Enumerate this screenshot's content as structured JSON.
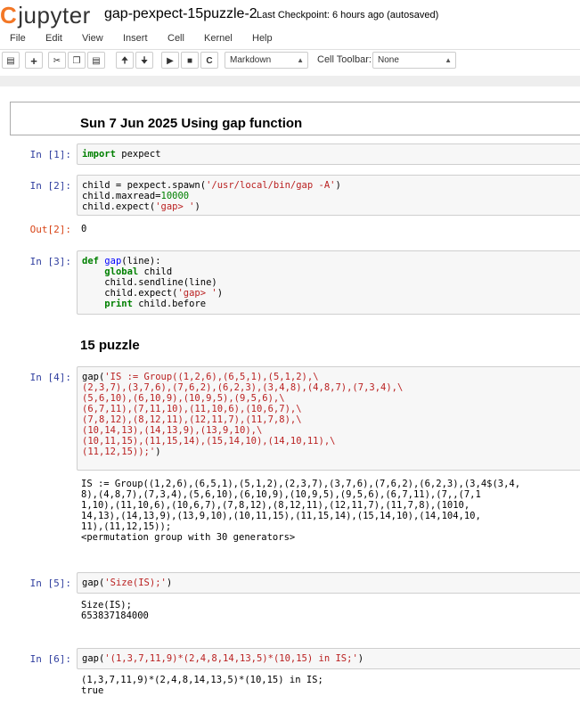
{
  "app": {
    "logo_text": "jupyter",
    "notebook_title": "gap-pexpect-15puzzle-2",
    "checkpoint": "Last Checkpoint: 6 hours ago (autosaved)"
  },
  "menu": [
    "File",
    "Edit",
    "View",
    "Insert",
    "Cell",
    "Kernel",
    "Help"
  ],
  "toolbar": {
    "cell_type": "Markdown",
    "cell_toolbar_label": "Cell Toolbar:",
    "cell_toolbar_value": "None",
    "icons": [
      "save-icon",
      "add-icon",
      "cut-icon",
      "copy-icon",
      "paste-icon",
      "move-up-icon",
      "move-down-icon",
      "run-icon",
      "stop-icon",
      "restart-icon"
    ]
  },
  "cells": {
    "md1": "Sun 7 Jun 2025 Using gap function",
    "h15": "15 puzzle",
    "in1": {
      "prompt": "In [1]:",
      "kw": "import",
      "rest": " pexpect"
    },
    "in2": {
      "prompt": "In [2]:",
      "l1a": "child = pexpect.spawn(",
      "l1s": "'/usr/local/bin/gap -A'",
      "l1b": ")",
      "l2a": "child.maxread=",
      "l2n": "10000",
      "l3a": "child.expect(",
      "l3s": "'gap> '",
      "l3b": ")"
    },
    "out2": {
      "prompt": "Out[2]:",
      "value": "0"
    },
    "in3": {
      "prompt": "In [3]:",
      "def": "def",
      "fname": "gap",
      "sig": "(line):",
      "global": "global",
      "gvar": " child",
      "l3": "    child.sendline(line)",
      "l4a": "    child.expect(",
      "l4s": "'gap> '",
      "l4b": ")",
      "print": "print",
      "pvar": " child.before"
    },
    "in4": {
      "prompt": "In [4]:",
      "head": "gap(",
      "lines": [
        "'IS := Group((1,2,6),(6,5,1),(5,1,2),\\",
        "(2,3,7),(3,7,6),(7,6,2),(6,2,3),(3,4,8),(4,8,7),(7,3,4),\\",
        "(5,6,10),(6,10,9),(10,9,5),(9,5,6),\\",
        "(6,7,11),(7,11,10),(11,10,6),(10,6,7),\\",
        "(7,8,12),(8,12,11),(12,11,7),(11,7,8),\\",
        "(10,14,13),(14,13,9),(13,9,10),\\",
        "(10,11,15),(11,15,14),(15,14,10),(14,10,11),\\",
        "(11,12,15));'"
      ],
      "tail": ")"
    },
    "out4": [
      "IS := Group((1,2,6),(6,5,1),(5,1,2),(2,3,7),(3,7,6),(7,6,2),(6,2,3),(3,4$(3,4,",
      "8),(4,8,7),(7,3,4),(5,6,10),(6,10,9),(10,9,5),(9,5,6),(6,7,11),(7,,(7,1",
      "1,10),(11,10,6),(10,6,7),(7,8,12),(8,12,11),(12,11,7),(11,7,8),(1010,",
      "14,13),(14,13,9),(13,9,10),(10,11,15),(11,15,14),(15,14,10),(14,104,10,",
      "11),(11,12,15));",
      "<permutation group with 30 generators>"
    ],
    "in5": {
      "prompt": "In [5]:",
      "a": "gap(",
      "s": "'Size(IS);'",
      "b": ")"
    },
    "out5": [
      "Size(IS);",
      "653837184000"
    ],
    "in6": {
      "prompt": "In [6]:",
      "a": "gap(",
      "s": "'(1,3,7,11,9)*(2,4,8,14,13,5)*(10,15) in IS;'",
      "b": ")"
    },
    "out6": [
      "(1,3,7,11,9)*(2,4,8,14,13,5)*(10,15) in IS;",
      "true"
    ]
  }
}
